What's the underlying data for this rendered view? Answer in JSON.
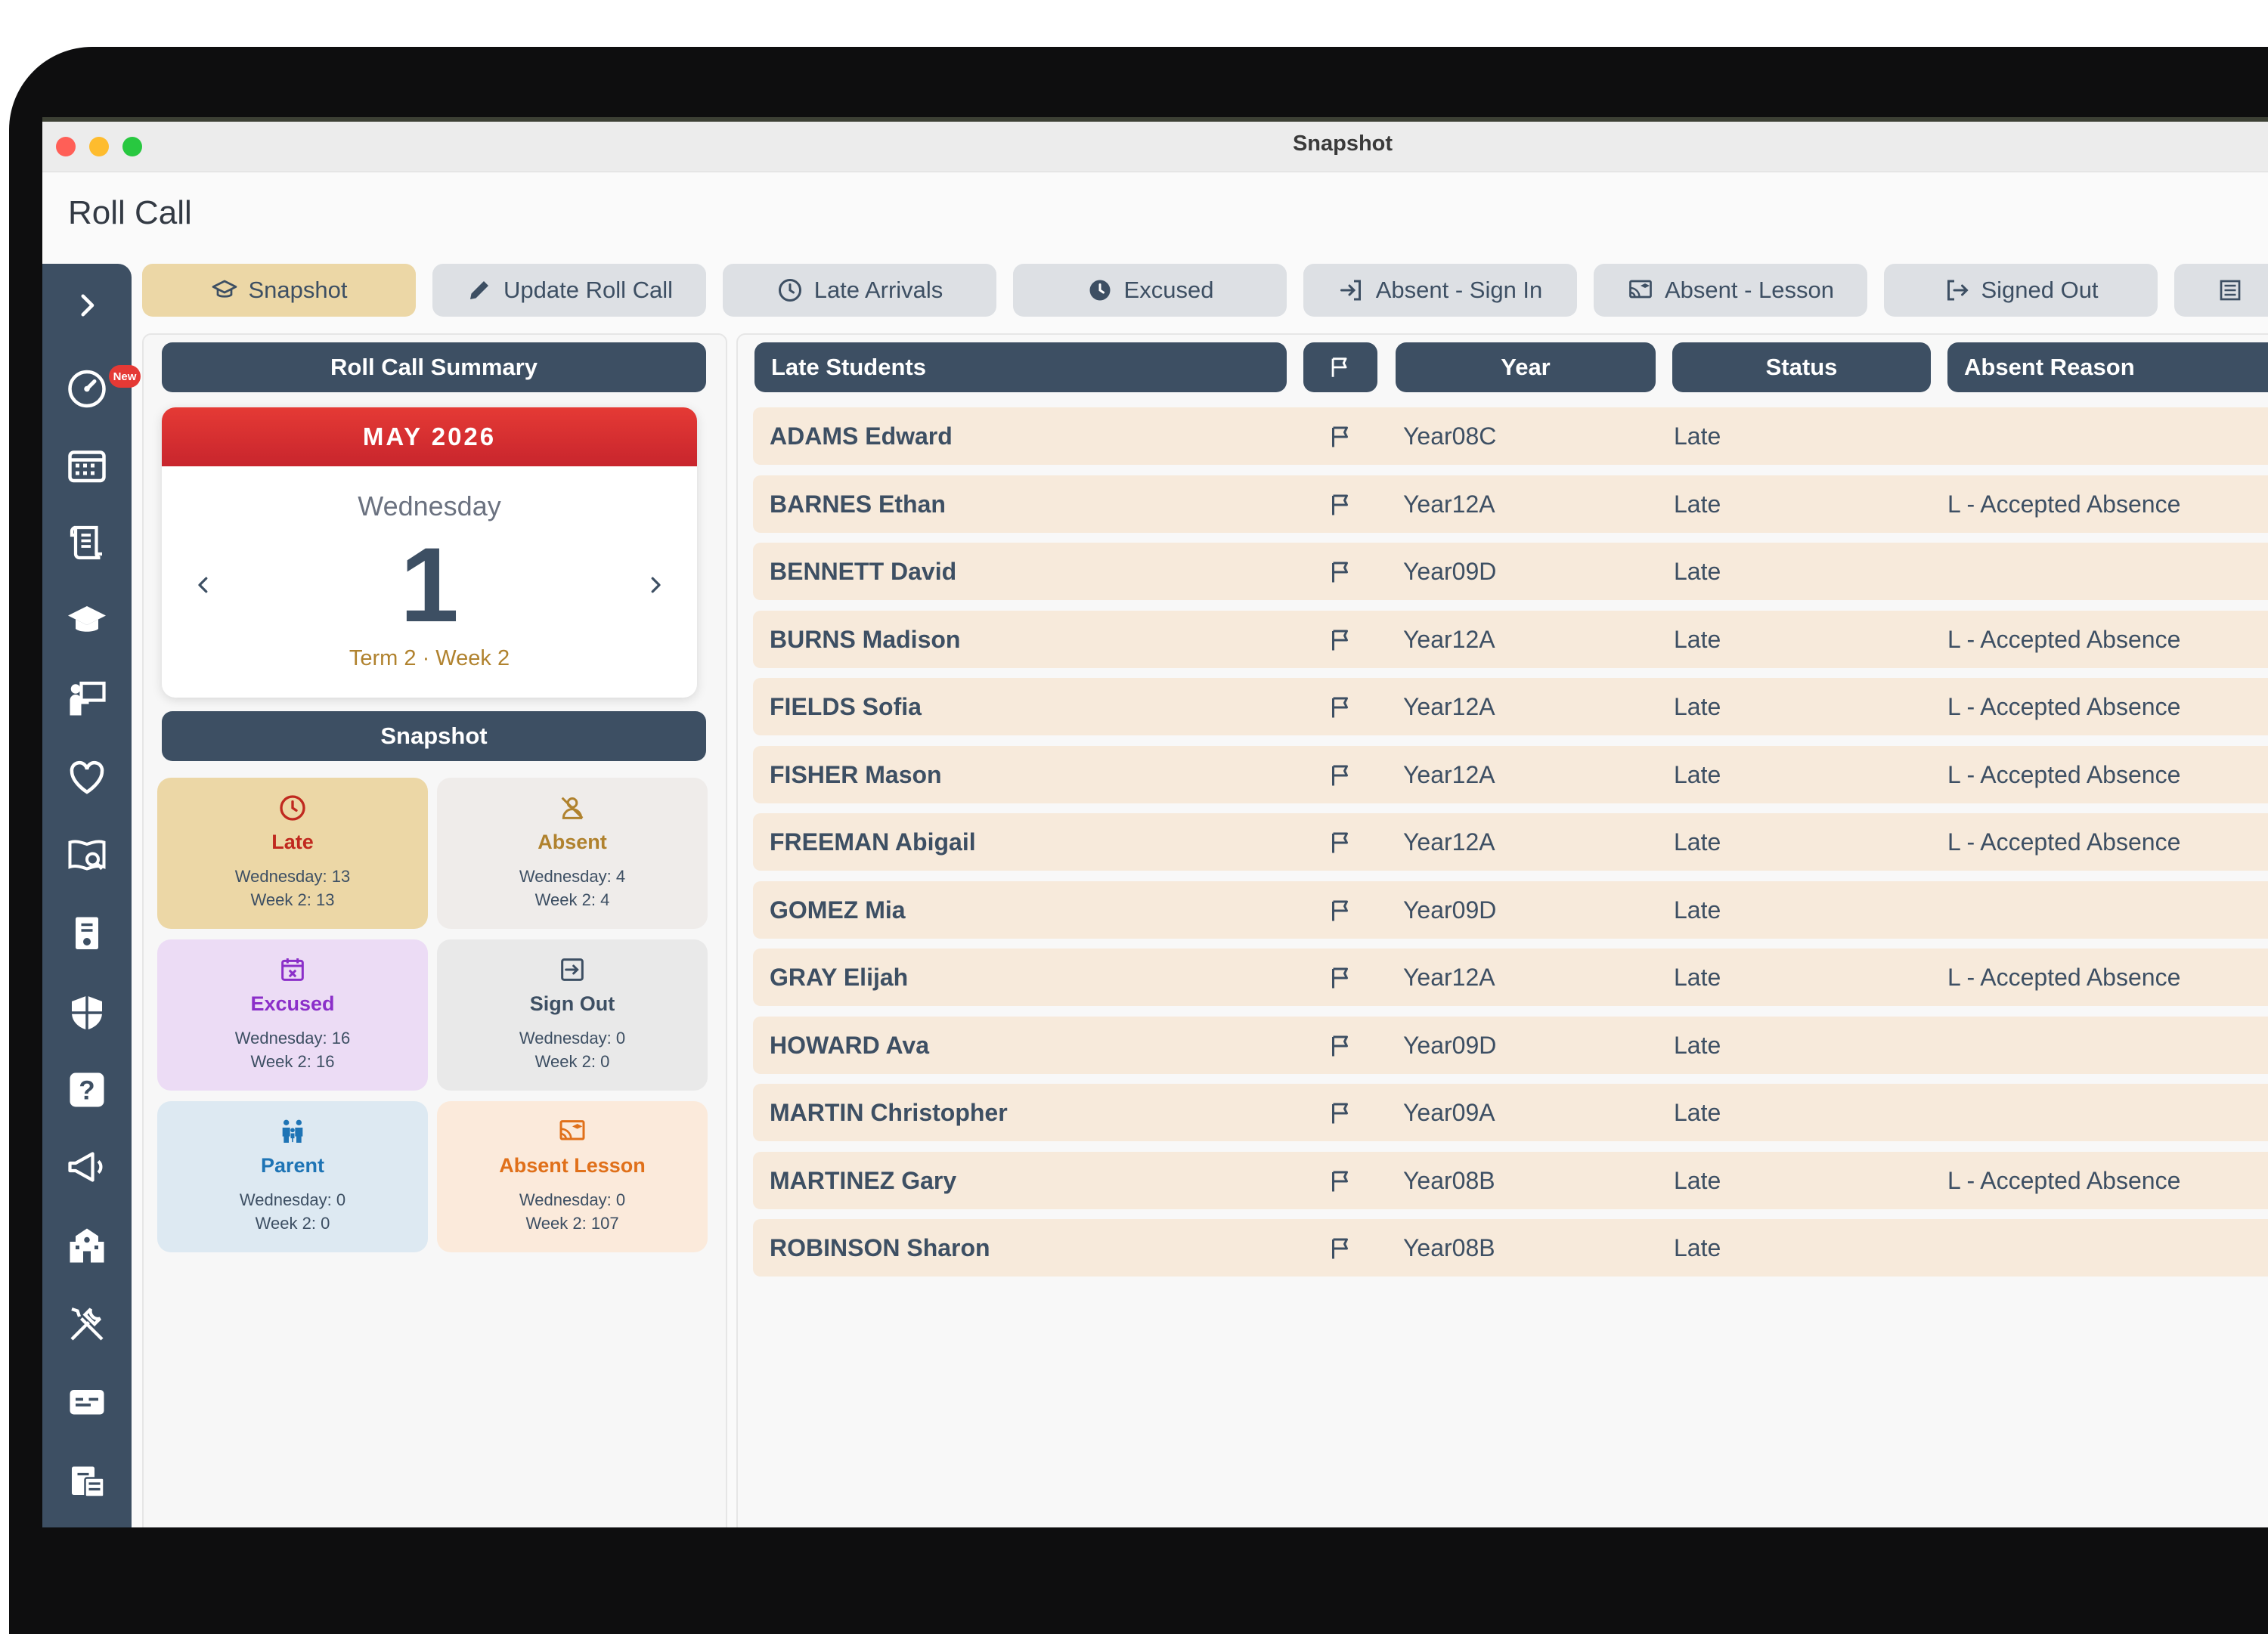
{
  "window": {
    "title": "Snapshot"
  },
  "page": {
    "title": "Roll Call"
  },
  "sidebar": {
    "new_badge": "New",
    "icons": [
      "chevron-right-icon",
      "dashboard-gauge-icon",
      "calendar-grid-icon",
      "scroll-icon",
      "graduation-cap-icon",
      "teacher-board-icon",
      "heart-icon",
      "book-search-icon",
      "document-person-icon",
      "shield-icon",
      "help-question-icon",
      "megaphone-icon",
      "school-building-icon",
      "tools-icon",
      "id-card-icon",
      "calculator-calendar-icon"
    ]
  },
  "tabs": [
    {
      "label": "Snapshot",
      "icon": "graduation-cap-icon",
      "active": true
    },
    {
      "label": "Update Roll Call",
      "icon": "pencil-icon"
    },
    {
      "label": "Late Arrivals",
      "icon": "clock-icon"
    },
    {
      "label": "Excused",
      "icon": "clock-filled-icon"
    },
    {
      "label": "Absent - Sign In",
      "icon": "sign-in-icon"
    },
    {
      "label": "Absent - Lesson",
      "icon": "cast-lesson-icon"
    },
    {
      "label": "Signed Out",
      "icon": "sign-out-icon"
    }
  ],
  "summary": {
    "header": "Roll Call Summary",
    "calendar": {
      "month": "MAY 2026",
      "weekday": "Wednesday",
      "day": "1",
      "term": "Term 2 · Week 2"
    },
    "snapshot_header": "Snapshot",
    "cards": [
      {
        "title": "Late",
        "line1": "Wednesday: 13",
        "line2": "Week 2: 13",
        "bg": "#ecd7a6",
        "color": "#c0291f"
      },
      {
        "title": "Absent",
        "line1": "Wednesday: 4",
        "line2": "Week 2: 4",
        "bg": "#efecea",
        "color": "#b0822e"
      },
      {
        "title": "Excused",
        "line1": "Wednesday: 16",
        "line2": "Week 2: 16",
        "bg": "#ecdcf5",
        "color": "#8b2fc9"
      },
      {
        "title": "Sign Out",
        "line1": "Wednesday: 0",
        "line2": "Week 2: 0",
        "bg": "#e9e9e9",
        "color": "#3d4f63"
      },
      {
        "title": "Parent",
        "line1": "Wednesday: 0",
        "line2": "Week 2: 0",
        "bg": "#dde9f2",
        "color": "#1e74b5"
      },
      {
        "title": "Absent Lesson",
        "line1": "Wednesday: 0",
        "line2": "Week 2: 107",
        "bg": "#fbeadb",
        "color": "#e0701a"
      }
    ]
  },
  "table": {
    "headers": {
      "student": "Late Students",
      "year": "Year",
      "status": "Status",
      "reason": "Absent Reason"
    },
    "rows": [
      {
        "name": "ADAMS Edward",
        "year": "Year08C",
        "status": "Late",
        "reason": ""
      },
      {
        "name": "BARNES Ethan",
        "year": "Year12A",
        "status": "Late",
        "reason": "L - Accepted Absence"
      },
      {
        "name": "BENNETT David",
        "year": "Year09D",
        "status": "Late",
        "reason": ""
      },
      {
        "name": "BURNS Madison",
        "year": "Year12A",
        "status": "Late",
        "reason": "L - Accepted Absence"
      },
      {
        "name": "FIELDS Sofia",
        "year": "Year12A",
        "status": "Late",
        "reason": "L - Accepted Absence"
      },
      {
        "name": "FISHER Mason",
        "year": "Year12A",
        "status": "Late",
        "reason": "L - Accepted Absence"
      },
      {
        "name": "FREEMAN Abigail",
        "year": "Year12A",
        "status": "Late",
        "reason": "L - Accepted Absence"
      },
      {
        "name": "GOMEZ Mia",
        "year": "Year09D",
        "status": "Late",
        "reason": ""
      },
      {
        "name": "GRAY Elijah",
        "year": "Year12A",
        "status": "Late",
        "reason": "L - Accepted Absence"
      },
      {
        "name": "HOWARD Ava",
        "year": "Year09D",
        "status": "Late",
        "reason": ""
      },
      {
        "name": "MARTIN Christopher",
        "year": "Year09A",
        "status": "Late",
        "reason": ""
      },
      {
        "name": "MARTINEZ Gary",
        "year": "Year08B",
        "status": "Late",
        "reason": "L - Accepted Absence"
      },
      {
        "name": "ROBINSON Sharon",
        "year": "Year08B",
        "status": "Late",
        "reason": ""
      }
    ]
  }
}
